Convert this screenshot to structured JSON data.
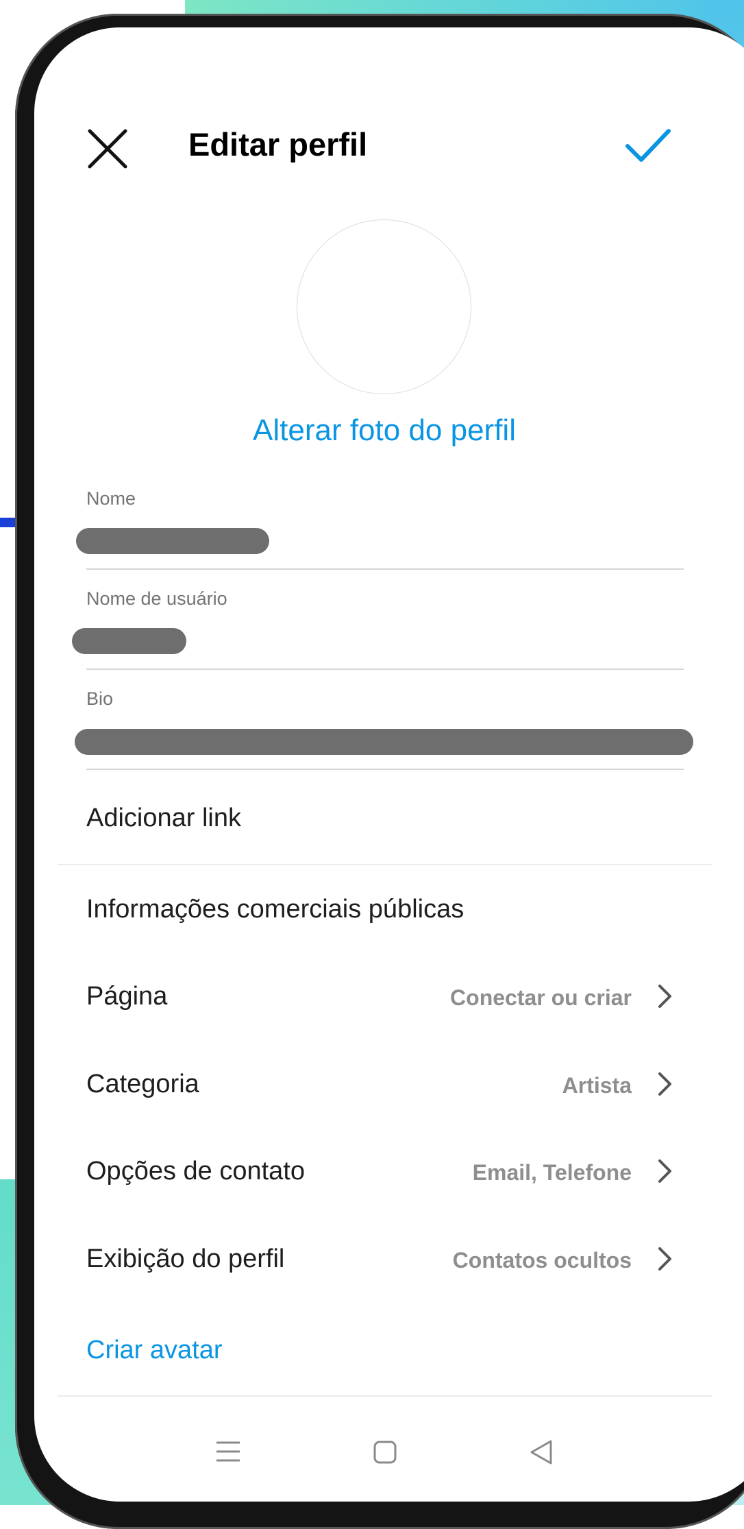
{
  "header": {
    "title": "Editar perfil"
  },
  "profile": {
    "change_photo_label": "Alterar foto do perfil"
  },
  "fields": {
    "name_label": "Nome",
    "username_label": "Nome de usuário",
    "bio_label": "Bio"
  },
  "add_link_label": "Adicionar link",
  "section_title": "Informações comerciais públicas",
  "rows": [
    {
      "label": "Página",
      "value": "Conectar ou criar"
    },
    {
      "label": "Categoria",
      "value": "Artista"
    },
    {
      "label": "Opções de contato",
      "value": "Email, Telefone"
    },
    {
      "label": "Exibição do perfil",
      "value": "Contatos ocultos"
    }
  ],
  "create_avatar_label": "Criar avatar",
  "colors": {
    "accent": "#0a95e3",
    "redaction": "#6e6e6e"
  },
  "icons": {
    "close": "close-icon",
    "confirm": "checkmark-icon",
    "chevron": "chevron-right-icon",
    "nav_menu": "menu-icon",
    "nav_home": "home-square-icon",
    "nav_back": "back-triangle-icon"
  }
}
